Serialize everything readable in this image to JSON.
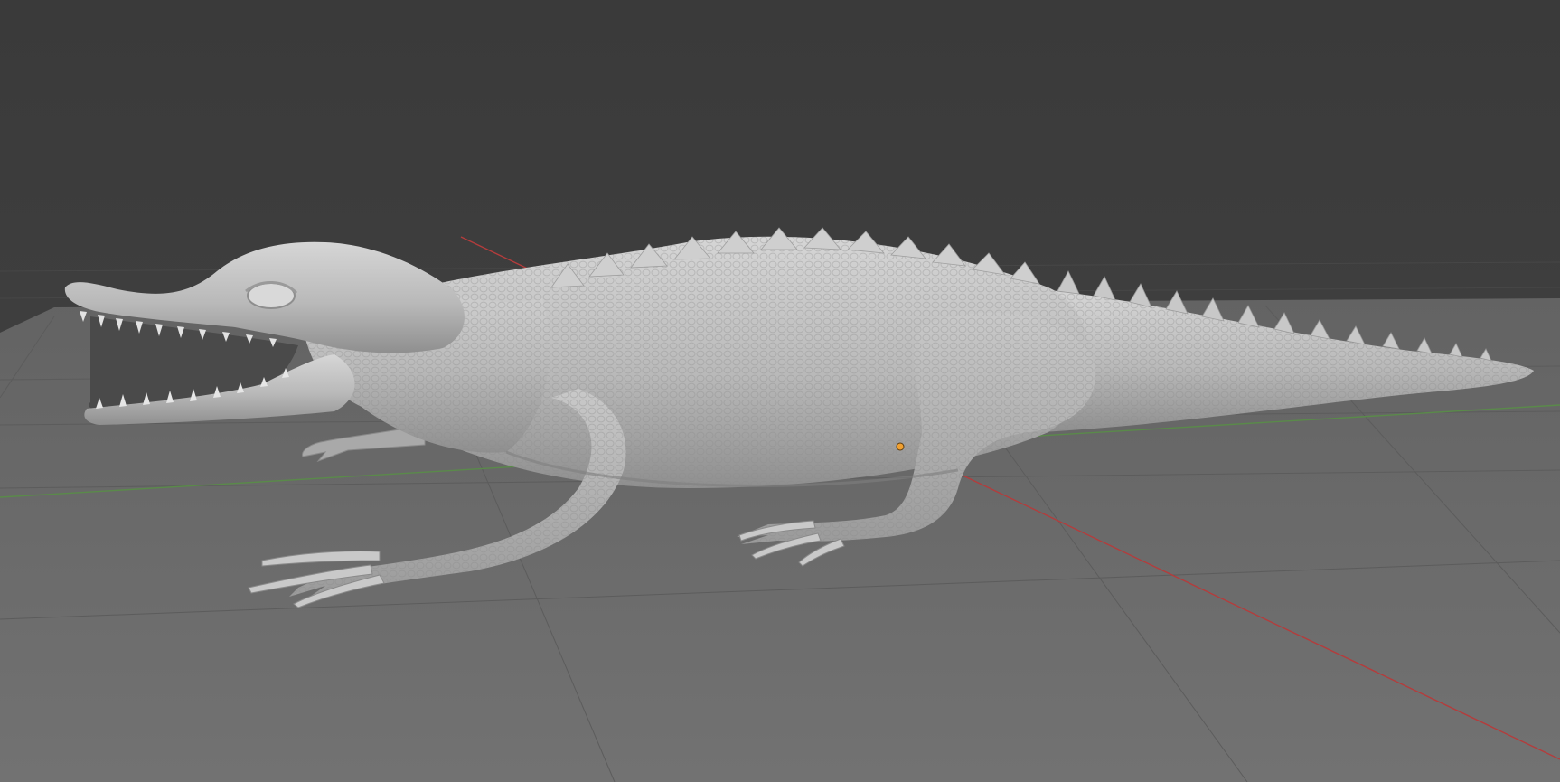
{
  "viewport": {
    "background_color": "#3d3d3d",
    "floor_color": "#6b6b6b",
    "grid_visible": true,
    "grid_line_color": "#5a5a5a",
    "x_axis_color": "#b43c3c",
    "y_axis_color": "#5a8a4a",
    "shading": "solid",
    "model_color": "#bdbdbd"
  },
  "scene": {
    "objects": [
      {
        "name": "crocodile",
        "icon": "sculpt-mesh-icon"
      }
    ],
    "origin_marker": {
      "icon": "object-origin-dot-icon",
      "color": "#f0a030"
    }
  }
}
